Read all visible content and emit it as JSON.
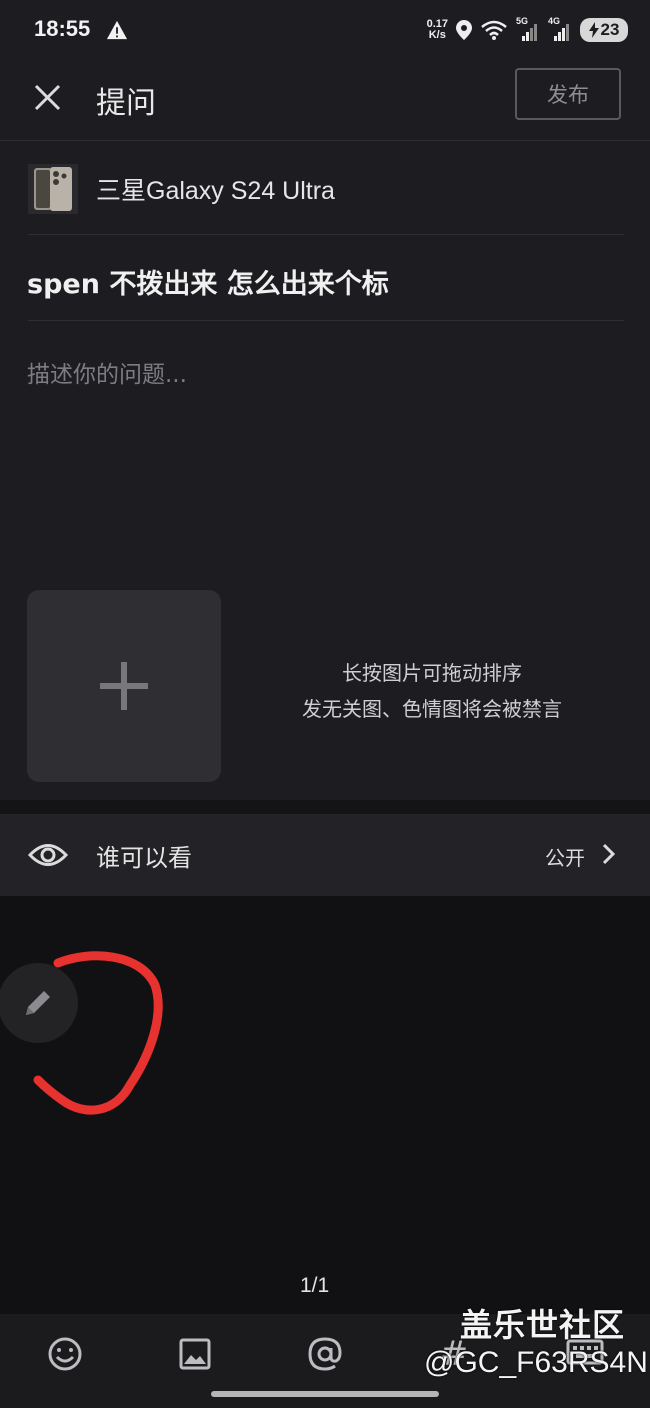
{
  "status_bar": {
    "time": "18:55",
    "speed_value": "0.17",
    "speed_unit": "K/s",
    "network_1": "5G",
    "network_2": "4G",
    "battery": "23"
  },
  "header": {
    "title": "提问",
    "publish_label": "发布"
  },
  "product": {
    "name": "三星Galaxy S24 Ultra"
  },
  "question": {
    "title": "spen  不拨出来 怎么出来个标",
    "description_placeholder": "描述你的问题..."
  },
  "images": {
    "hint_line1": "长按图片可拖动排序",
    "hint_line2": "发无关图、色情图将会被禁言"
  },
  "visibility": {
    "label": "谁可以看",
    "value": "公开"
  },
  "pager": "1/1",
  "toolbar": {
    "hash_symbol": "#"
  },
  "watermark": {
    "line1": "盖乐世社区",
    "line2": "@GC_F63RS4N"
  },
  "colors": {
    "background": "#1d1d21",
    "annotation_red": "#e8322f"
  }
}
